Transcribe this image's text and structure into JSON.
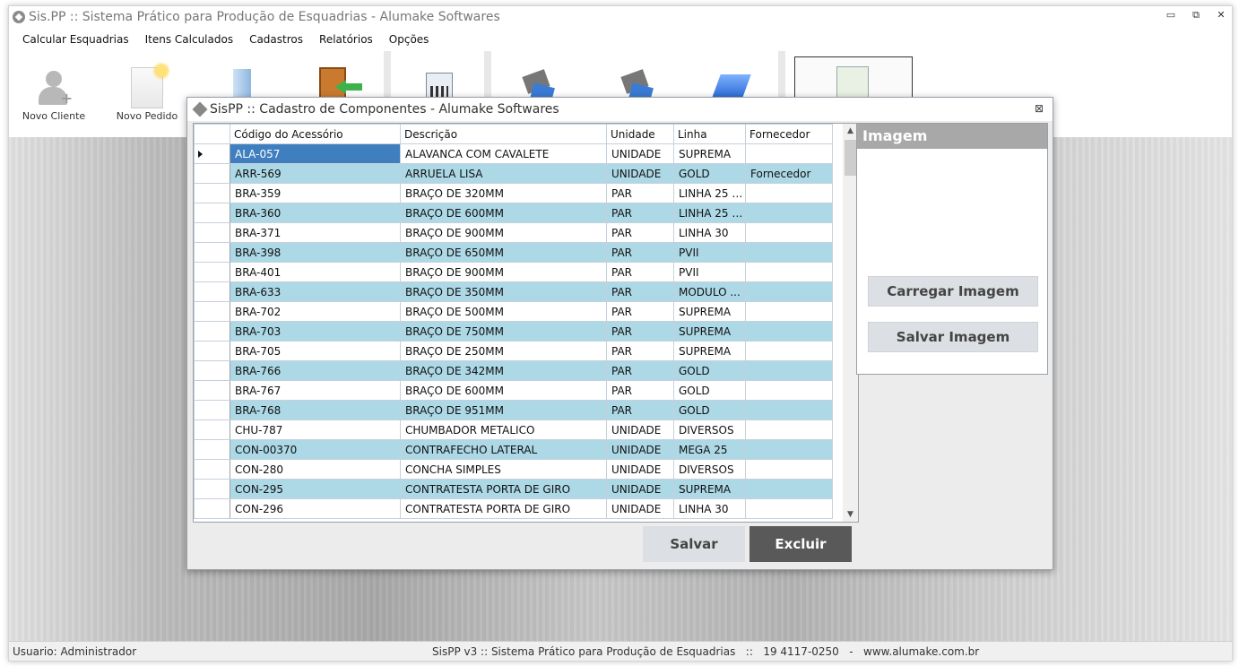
{
  "window": {
    "title": "Sis.PP :: Sistema Prático para Produção de Esquadrias - Alumake Softwares"
  },
  "menu": [
    "Calcular Esquadrias",
    "Itens Calculados",
    "Cadastros",
    "Relatórios",
    "Opções"
  ],
  "toolbar": {
    "novo_cliente": "Novo Cliente",
    "novo_pedido": "Novo Pedido"
  },
  "dialog": {
    "title": "SisPP :: Cadastro de Componentes - Alumake Softwares",
    "columns": [
      "Código do Acessório",
      "Descrição",
      "Unidade",
      "Linha",
      "Fornecedor"
    ],
    "rows": [
      {
        "codigo": "ALA-057",
        "descricao": "ALAVANCA COM CAVALETE",
        "unidade": "UNIDADE",
        "linha": "SUPREMA",
        "fornecedor": ""
      },
      {
        "codigo": "ARR-569",
        "descricao": "ARRUELA LISA",
        "unidade": "UNIDADE",
        "linha": "GOLD",
        "fornecedor": "Fornecedor"
      },
      {
        "codigo": "BRA-359",
        "descricao": "BRAÇO DE 320MM",
        "unidade": "PAR",
        "linha": "LINHA 25 /...",
        "fornecedor": ""
      },
      {
        "codigo": "BRA-360",
        "descricao": "BRAÇO DE 600MM",
        "unidade": "PAR",
        "linha": "LINHA 25 /...",
        "fornecedor": ""
      },
      {
        "codigo": "BRA-371",
        "descricao": "BRAÇO DE 900MM",
        "unidade": "PAR",
        "linha": "LINHA 30",
        "fornecedor": ""
      },
      {
        "codigo": "BRA-398",
        "descricao": "BRAÇO DE 650MM",
        "unidade": "PAR",
        "linha": "PVII",
        "fornecedor": ""
      },
      {
        "codigo": "BRA-401",
        "descricao": "BRAÇO DE 900MM",
        "unidade": "PAR",
        "linha": "PVII",
        "fornecedor": ""
      },
      {
        "codigo": "BRA-633",
        "descricao": "BRAÇO DE 350MM",
        "unidade": "PAR",
        "linha": "MODULO ...",
        "fornecedor": ""
      },
      {
        "codigo": "BRA-702",
        "descricao": "BRAÇO DE 500MM",
        "unidade": "PAR",
        "linha": "SUPREMA",
        "fornecedor": ""
      },
      {
        "codigo": "BRA-703",
        "descricao": "BRAÇO DE 750MM",
        "unidade": "PAR",
        "linha": "SUPREMA",
        "fornecedor": ""
      },
      {
        "codigo": "BRA-705",
        "descricao": "BRAÇO DE 250MM",
        "unidade": "PAR",
        "linha": "SUPREMA",
        "fornecedor": ""
      },
      {
        "codigo": "BRA-766",
        "descricao": "BRAÇO DE 342MM",
        "unidade": "PAR",
        "linha": "GOLD",
        "fornecedor": ""
      },
      {
        "codigo": "BRA-767",
        "descricao": "BRAÇO DE 600MM",
        "unidade": "PAR",
        "linha": "GOLD",
        "fornecedor": ""
      },
      {
        "codigo": "BRA-768",
        "descricao": "BRAÇO DE 951MM",
        "unidade": "PAR",
        "linha": "GOLD",
        "fornecedor": ""
      },
      {
        "codigo": "CHU-787",
        "descricao": "CHUMBADOR METALICO",
        "unidade": "UNIDADE",
        "linha": "DIVERSOS",
        "fornecedor": ""
      },
      {
        "codigo": "CON-00370",
        "descricao": "CONTRAFECHO LATERAL",
        "unidade": "UNIDADE",
        "linha": "MEGA 25",
        "fornecedor": ""
      },
      {
        "codigo": "CON-280",
        "descricao": "CONCHA SIMPLES",
        "unidade": "UNIDADE",
        "linha": "DIVERSOS",
        "fornecedor": ""
      },
      {
        "codigo": "CON-295",
        "descricao": "CONTRATESTA PORTA DE GIRO",
        "unidade": "UNIDADE",
        "linha": "SUPREMA",
        "fornecedor": ""
      },
      {
        "codigo": "CON-296",
        "descricao": "CONTRATESTA PORTA DE GIRO",
        "unidade": "UNIDADE",
        "linha": "LINHA 30",
        "fornecedor": ""
      }
    ],
    "image_panel": {
      "header": "Imagem",
      "load_label": "Carregar Imagem",
      "save_label": "Salvar Imagem"
    },
    "save_label": "Salvar",
    "delete_label": "Excluir",
    "close_icon": "⊠"
  },
  "status": {
    "user": "Usuario: Administrador",
    "info": "SisPP v3 :: Sistema Prático para Produção de Esquadrias   ::   19 4117-0250   -   www.alumake.com.br"
  },
  "colors": {
    "row_alt": "#add8e6",
    "row_selected": "#3f7fbf",
    "delete_button": "#595959"
  }
}
